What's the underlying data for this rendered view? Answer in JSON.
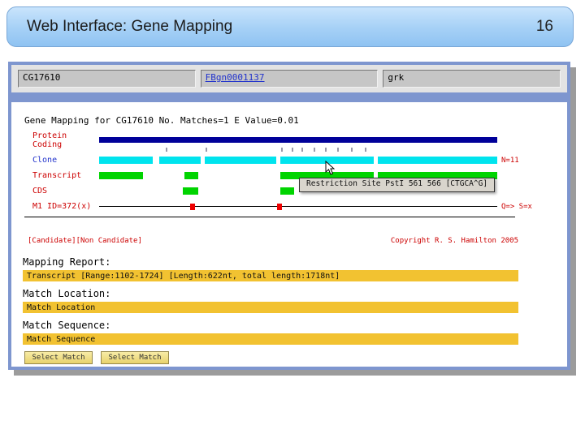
{
  "slide": {
    "title": "Web Interface: Gene Mapping",
    "page_number": "16"
  },
  "query_bar": {
    "fields": [
      {
        "value": "CG17610",
        "color": "#000000"
      },
      {
        "value": "FBgn0001137",
        "color": "#2233cc"
      },
      {
        "value": "grk",
        "color": "#000000"
      }
    ]
  },
  "viewer": {
    "summary": "Gene Mapping for CG17610 No. Matches=1 E Value=0.01",
    "tracks": [
      {
        "label": "Protein Coding",
        "label_color": "#cc0000",
        "segments": [
          {
            "l": 0,
            "w": 100,
            "c": "#000099",
            "h": 7
          }
        ]
      },
      {
        "label": "Clone",
        "label_color": "#2233cc",
        "right_label": "N=11",
        "segments": [
          {
            "l": 0,
            "w": 13.5,
            "c": "#00e4ee"
          },
          {
            "l": 15,
            "w": 10.5,
            "c": "#00e4ee"
          },
          {
            "l": 26.5,
            "w": 18.0,
            "c": "#00e4ee"
          },
          {
            "l": 45.5,
            "w": 23.5,
            "c": "#00e4ee"
          },
          {
            "l": 70,
            "w": 30,
            "c": "#00e4ee"
          }
        ]
      },
      {
        "label": "Transcript",
        "label_color": "#cc0000",
        "segments": [
          {
            "l": 0,
            "w": 11,
            "c": "#00d400"
          },
          {
            "l": 21.5,
            "w": 3.5,
            "c": "#00d400"
          },
          {
            "l": 45.5,
            "w": 23.5,
            "c": "#00d400"
          },
          {
            "l": 70,
            "w": 30,
            "c": "#00d400"
          }
        ]
      },
      {
        "label": "CDS",
        "label_color": "#cc0000",
        "segments": [
          {
            "l": 21,
            "w": 4,
            "c": "#00d400"
          },
          {
            "l": 45.5,
            "w": 3.5,
            "c": "#00d400"
          }
        ]
      },
      {
        "label": "M1 ID=372(x)",
        "label_color": "#cc0000",
        "right_label": "Q=> S=x",
        "marks": [
          {
            "l": 23.5,
            "c": "#ee0000"
          },
          {
            "l": 45.3,
            "c": "#ee0000"
          }
        ]
      }
    ],
    "match_ticks": [
      {
        "l": 17,
        "c": "#333355"
      },
      {
        "l": 27,
        "c": "#333355"
      },
      {
        "l": 46,
        "c": "#333355"
      },
      {
        "l": 48.5,
        "c": "#333355"
      },
      {
        "l": 51,
        "c": "#333355"
      },
      {
        "l": 54,
        "c": "#333355"
      },
      {
        "l": 57,
        "c": "#333355"
      },
      {
        "l": 60,
        "c": "#333355"
      },
      {
        "l": 63.5,
        "c": "#333355"
      },
      {
        "l": 67,
        "c": "#333355"
      }
    ],
    "tooltip": "Restriction Site PstI 561 566 [CTGCA^G]",
    "candidate_legend": "[Candidate][Non Candidate]",
    "copyright": "Copyright R. S. Hamilton 2005"
  },
  "report": {
    "heading": "Mapping Report:",
    "transcript_summary": "Transcript [Range:1102-1724] [Length:622nt, total length:1718nt]",
    "match_location_label": "Match Location:",
    "match_location_value": "Match Location",
    "match_sequence_label": "Match Sequence:",
    "match_sequence_value": "Match Sequence",
    "buttons": [
      {
        "label": "Select Match"
      },
      {
        "label": "Select Match"
      }
    ],
    "bar_color": "#f2c231"
  }
}
